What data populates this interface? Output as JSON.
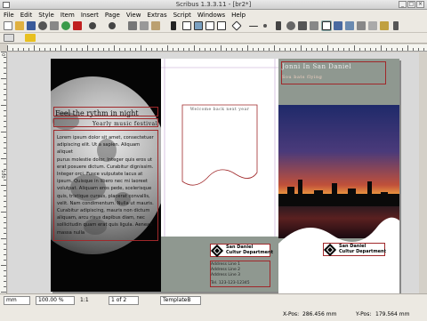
{
  "window": {
    "title": "Scribus 1.3.3.11 - [br2*]"
  },
  "menu": [
    "File",
    "Edit",
    "Style",
    "Item",
    "Insert",
    "Page",
    "View",
    "Extras",
    "Script",
    "Windows",
    "Help"
  ],
  "ruler": {
    "v_label_top": "0",
    "v_label_mid": "100"
  },
  "document": {
    "headline": "Feel the rythm in night",
    "subhead": "Yearly music festival",
    "body_lines": [
      "Lorem ipsum dolor sit amet, consectetuer",
      "adipiscing elit. Ut a sapien. Aliquam aliquet",
      "purus molestie dolor. Integer quis eros ut",
      "erat posuere dictum. Curabitur dignissim.",
      "Integer orci. Fusce vulputate lacus at",
      "ipsum. Quisque in libero nec mi laoreet",
      "volutpat. Aliquam eros pede, scelerisque",
      "quis, tristique cursus, placerat convallis,",
      "velit. Nam condimentum. Nulla ut mauris.",
      "Curabitur adipiscing, mauris non dictum",
      "aliquam, arcu risus dapibus diam, nec",
      "sollicitudin quam erat quis ligula. Aenean",
      "massa nulla"
    ],
    "tagline": "Welcome back next year",
    "logo_name": "San Daniel",
    "logo_dept": "Cultur Department",
    "address_lines": [
      "Address Line 1",
      "Address Line 2",
      "Address Line 3"
    ],
    "phone": "Tel. 123-123-12345",
    "right_title": "Jonni In San Daniel",
    "right_sub": "Sou bats flying"
  },
  "status": {
    "unit": "mm",
    "zoom": "100.00 %",
    "ratio": "1:1",
    "page": "1 of 2",
    "template": "TemplateB",
    "xpos_label": "X-Pos:",
    "xpos_value": "286.456 mm",
    "ypos_label": "Y-Pos:",
    "ypos_value": "179.564 mm"
  },
  "colors": {
    "frame": "#a0282a",
    "panel_gray": "#8f9890"
  },
  "icons": [
    "new-icon",
    "open-icon",
    "save-icon",
    "close-icon",
    "print-icon",
    "pdf-icon",
    "undo-icon",
    "redo-icon",
    "cut-icon",
    "copy-icon",
    "paste-icon",
    "select-icon",
    "text-frame-icon",
    "image-frame-icon",
    "shape-icon",
    "polygon-icon",
    "line-icon",
    "bezier-icon",
    "freehand-icon",
    "rotate-icon",
    "zoom-icon",
    "edit-text-icon",
    "link-icon",
    "unlink-icon",
    "table-icon",
    "measure-icon",
    "eyedropper-icon"
  ]
}
